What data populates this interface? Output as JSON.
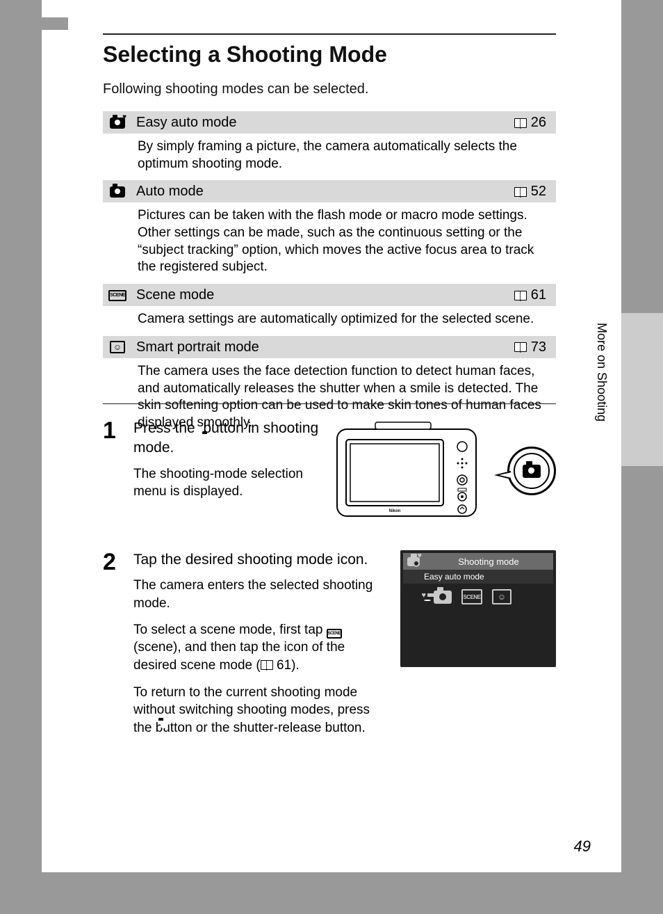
{
  "section_header": "More on Shooting",
  "page_title": "Selecting a Shooting Mode",
  "intro": "Following shooting modes can be selected.",
  "modes": [
    {
      "icon": "camera-heart",
      "label": "Easy auto mode",
      "page_ref": "26",
      "description": "By simply framing a picture, the camera automatically selects the optimum shooting mode."
    },
    {
      "icon": "camera",
      "label": "Auto mode",
      "page_ref": "52",
      "description": "Pictures can be taken with the flash mode or macro mode settings. Other settings can be made, such as the continuous setting or the “subject tracking” option, which moves the active focus area to track the registered subject."
    },
    {
      "icon": "scene",
      "label": "Scene mode",
      "page_ref": "61",
      "description": "Camera settings are automatically optimized for the selected scene."
    },
    {
      "icon": "smile",
      "label": "Smart portrait mode",
      "page_ref": "73",
      "description": "The camera uses the face detection function to detect human faces, and automatically releases the shutter when a smile is detected. The skin softening option can be used to make skin tones of human faces displayed smoothly."
    }
  ],
  "steps": {
    "s1": {
      "num": "1",
      "title_a": "Press the ",
      "title_b": " button in shooting mode.",
      "text": "The shooting-mode selection menu is displayed."
    },
    "s2": {
      "num": "2",
      "title": "Tap the desired shooting mode icon.",
      "p1": "The camera enters the selected shooting mode.",
      "p2a": "To select a scene mode, first tap ",
      "p2b": " (scene), and then tap the icon of the desired scene mode (",
      "p2c": " 61).",
      "p3a": "To return to the current shooting mode without switching shooting modes, press the ",
      "p3b": " button or the shutter-release button."
    }
  },
  "lcd": {
    "title": "Shooting mode",
    "sub": "Easy auto mode"
  },
  "scene_text": "SCENE",
  "side_label": "More on Shooting",
  "page_number": "49"
}
